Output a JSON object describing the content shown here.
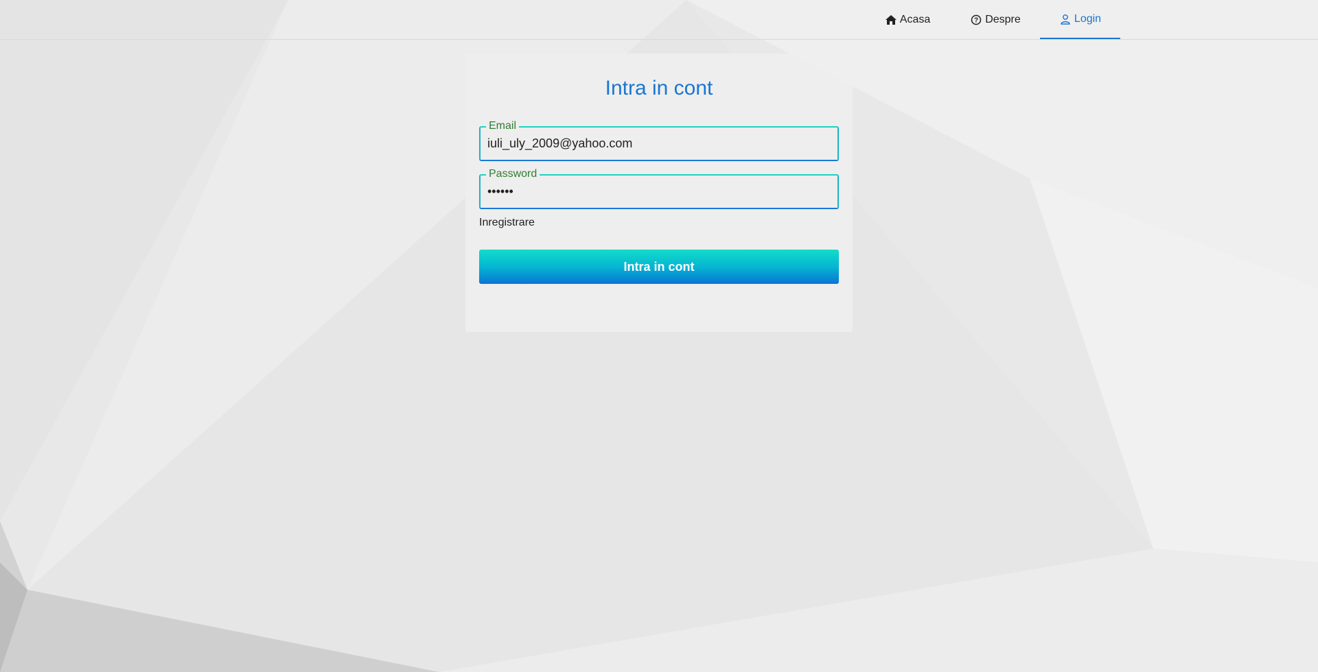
{
  "nav": {
    "items": [
      {
        "label": "Acasa",
        "icon": "home-icon"
      },
      {
        "label": "Despre",
        "icon": "question-circle-icon"
      },
      {
        "label": "Login",
        "icon": "user-icon"
      }
    ],
    "active": "Login",
    "active_color": "#1976d2"
  },
  "login_form": {
    "title": "Intra in cont",
    "email": {
      "label": "Email",
      "value": "iuli_uly_2009@yahoo.com"
    },
    "password": {
      "label": "Password",
      "value": "••••••"
    },
    "register_link": "Inregistrare",
    "submit_label": "Intra in cont",
    "field_label_color": "#2e7d32",
    "button_gradient": [
      "#12ddc8",
      "#0a74d4"
    ]
  }
}
